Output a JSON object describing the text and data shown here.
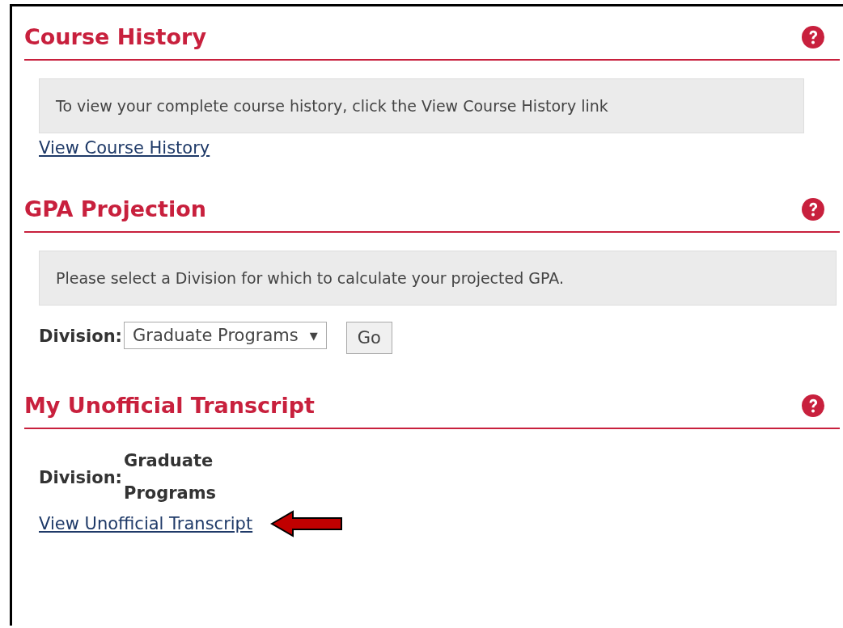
{
  "sections": [
    {
      "kind": "info",
      "title": "Course History",
      "message": "To view your complete course history, click the View Course History link",
      "link": "View Course History"
    },
    {
      "kind": "projection",
      "title": "GPA Projection",
      "message": "Please select a Division for which to calculate your projected GPA.",
      "division_label": "Division:",
      "select_value": "Graduate Programs",
      "select_caret": "▼",
      "button": "Go"
    },
    {
      "kind": "transcript",
      "title": "My Unofficial Transcript",
      "division_label": "Division:",
      "division_value": "Graduate Programs",
      "link": "View Unofficial Transcript"
    }
  ]
}
